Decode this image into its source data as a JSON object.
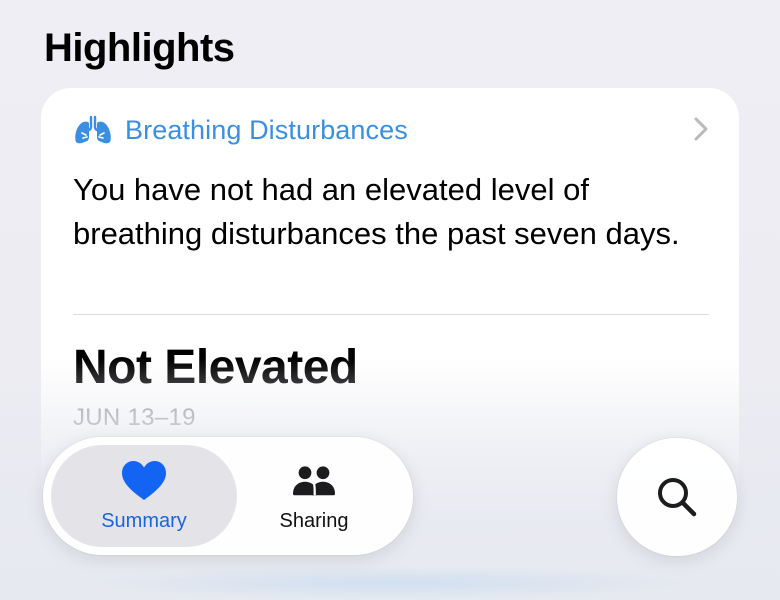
{
  "section": {
    "title": "Highlights"
  },
  "card": {
    "category": "Breathing Disturbances",
    "category_icon": "lungs-icon",
    "message": "You have not had an elevated level of breathing disturbances the past seven days.",
    "value": "Not Elevated",
    "date_range": "JUN 13–19",
    "accent_color": "#3b8fe0"
  },
  "tabs": [
    {
      "label": "Summary",
      "icon": "heart-icon",
      "selected": true,
      "color": "#1a64e0"
    },
    {
      "label": "Sharing",
      "icon": "people-icon",
      "selected": false,
      "color": "#111111"
    }
  ],
  "search": {
    "icon": "search-icon"
  }
}
